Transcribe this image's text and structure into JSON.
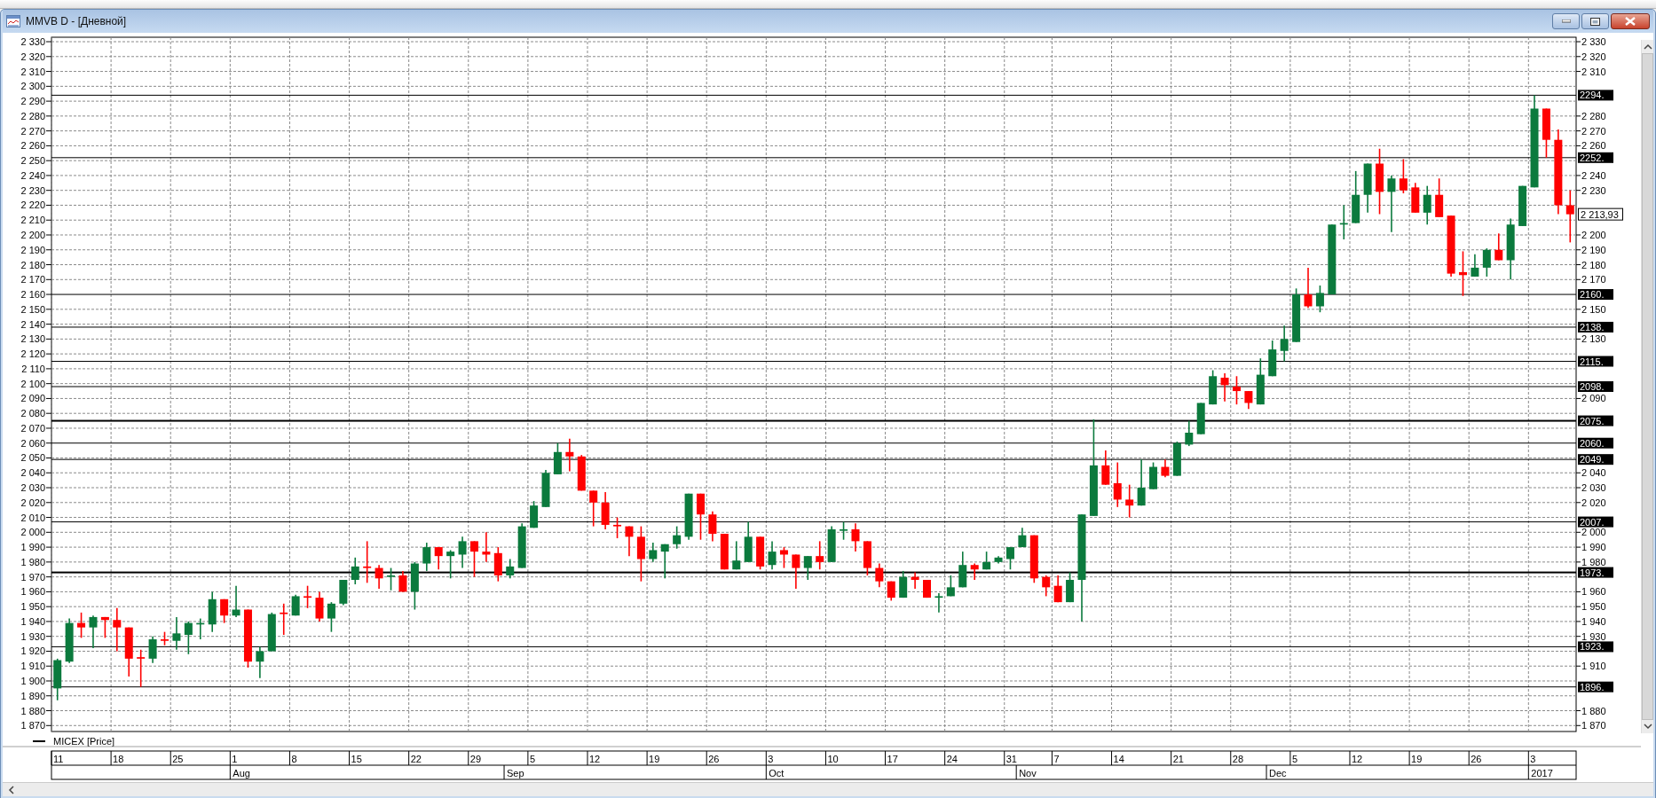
{
  "window": {
    "title": "MMVB D - [Дневной]"
  },
  "chart": {
    "chart_data": {
      "type": "candlestick",
      "grid": true,
      "categories": [
        "11",
        null,
        null,
        null,
        null,
        "18",
        null,
        null,
        null,
        null,
        "25",
        null,
        null,
        null,
        null,
        "1",
        null,
        null,
        null,
        null,
        "8",
        null,
        null,
        null,
        null,
        "15",
        null,
        null,
        null,
        null,
        "22",
        null,
        null,
        null,
        null,
        "29",
        null,
        null,
        null,
        null,
        "5",
        null,
        null,
        null,
        null,
        "12",
        null,
        null,
        null,
        null,
        "19",
        null,
        null,
        null,
        null,
        "26",
        null,
        null,
        null,
        null,
        "3",
        null,
        null,
        null,
        null,
        "10",
        null,
        null,
        null,
        null,
        "17",
        null,
        null,
        null,
        null,
        "24",
        null,
        null,
        null,
        null,
        "31",
        null,
        null,
        null,
        "7",
        null,
        null,
        null,
        null,
        "14",
        null,
        null,
        null,
        null,
        "21",
        null,
        null,
        null,
        null,
        "28",
        null,
        null,
        null,
        null,
        "5",
        null,
        null,
        null,
        null,
        "12",
        null,
        null,
        null,
        null,
        "19",
        null,
        null,
        null,
        null,
        "26",
        null,
        null,
        null,
        null,
        "3",
        null,
        null,
        null
      ],
      "series": [
        {
          "ohlc": [
            [
              1895,
              1915,
              1887,
              1914
            ],
            [
              1913,
              1942,
              1912,
              1939
            ],
            [
              1939,
              1946,
              1929,
              1936
            ],
            [
              1936,
              1944,
              1922,
              1943
            ],
            [
              1943,
              1943,
              1929,
              1941
            ],
            [
              1941,
              1949,
              1920,
              1936
            ],
            [
              1936,
              1936,
              1903,
              1915
            ],
            [
              1916,
              1921,
              1896,
              1915
            ],
            [
              1915,
              1930,
              1912,
              1928
            ],
            [
              1928,
              1933,
              1924,
              1927
            ],
            [
              1927,
              1943,
              1921,
              1932
            ],
            [
              1931,
              1940,
              1918,
              1939
            ],
            [
              1938,
              1942,
              1928,
              1939
            ],
            [
              1938,
              1960,
              1933,
              1955
            ],
            [
              1955,
              1955,
              1939,
              1944
            ],
            [
              1944,
              1964,
              1943,
              1948
            ],
            [
              1948,
              1948,
              1909,
              1913
            ],
            [
              1913,
              1923,
              1902,
              1920
            ],
            [
              1920,
              1946,
              1920,
              1945
            ],
            [
              1946,
              1952,
              1931,
              1945
            ],
            [
              1944,
              1958,
              1944,
              1957
            ],
            [
              1957,
              1964,
              1949,
              1956
            ],
            [
              1956,
              1960,
              1940,
              1942
            ],
            [
              1942,
              1953,
              1933,
              1952
            ],
            [
              1952,
              1968,
              1951,
              1968
            ],
            [
              1968,
              1983,
              1965,
              1977
            ],
            [
              1977,
              1994,
              1966,
              1976
            ],
            [
              1976,
              1978,
              1962,
              1969
            ],
            [
              1970,
              1976,
              1961,
              1971
            ],
            [
              1971,
              1974,
              1960,
              1960
            ],
            [
              1960,
              1980,
              1948,
              1979
            ],
            [
              1979,
              1993,
              1974,
              1990
            ],
            [
              1990,
              1990,
              1975,
              1984
            ],
            [
              1984,
              1988,
              1969,
              1987
            ],
            [
              1985,
              1997,
              1976,
              1994
            ],
            [
              1994,
              1994,
              1970,
              1987
            ],
            [
              1987,
              2000,
              1980,
              1985
            ],
            [
              1986,
              1990,
              1967,
              1971
            ],
            [
              1971,
              1982,
              1969,
              1977
            ],
            [
              1976,
              2006,
              1976,
              2004
            ],
            [
              2003,
              2021,
              2003,
              2018
            ],
            [
              2017,
              2042,
              2017,
              2040
            ],
            [
              2039,
              2060,
              2039,
              2054
            ],
            [
              2054,
              2063,
              2041,
              2051
            ],
            [
              2051,
              2052,
              2028,
              2028
            ],
            [
              2028,
              2028,
              2004,
              2020
            ],
            [
              2020,
              2027,
              2002,
              2005
            ],
            [
              2005,
              2010,
              1996,
              2004
            ],
            [
              2004,
              2004,
              1984,
              1997
            ],
            [
              1997,
              2004,
              1967,
              1982
            ],
            [
              1982,
              1993,
              1980,
              1988
            ],
            [
              1987,
              1992,
              1969,
              1992
            ],
            [
              1992,
              2004,
              1989,
              1998
            ],
            [
              1997,
              2026,
              1995,
              2026
            ],
            [
              2026,
              2026,
              1995,
              2012
            ],
            [
              2012,
              2014,
              1994,
              1999
            ],
            [
              1999,
              1999,
              1975,
              1975
            ],
            [
              1975,
              1994,
              1975,
              1981
            ],
            [
              1980,
              2007,
              1980,
              1997
            ],
            [
              1997,
              1997,
              1975,
              1977
            ],
            [
              1978,
              1994,
              1975,
              1987
            ],
            [
              1988,
              1990,
              1976,
              1985
            ],
            [
              1985,
              1985,
              1962,
              1976
            ],
            [
              1976,
              1984,
              1968,
              1984
            ],
            [
              1984,
              1994,
              1975,
              1980
            ],
            [
              1980,
              2004,
              1980,
              2002
            ],
            [
              2001,
              2007,
              1995,
              2002
            ],
            [
              2002,
              2006,
              1987,
              1994
            ],
            [
              1994,
              1994,
              1971,
              1976
            ],
            [
              1976,
              1979,
              1963,
              1967
            ],
            [
              1967,
              1967,
              1954,
              1956
            ],
            [
              1956,
              1974,
              1956,
              1970
            ],
            [
              1970,
              1973,
              1962,
              1968
            ],
            [
              1968,
              1968,
              1956,
              1956
            ],
            [
              1956,
              1959,
              1946,
              1957
            ],
            [
              1957,
              1971,
              1957,
              1963
            ],
            [
              1963,
              1987,
              1963,
              1978
            ],
            [
              1978,
              1979,
              1968,
              1975
            ],
            [
              1975,
              1987,
              1975,
              1980
            ],
            [
              1980,
              1984,
              1979,
              1983
            ],
            [
              1982,
              1990,
              1975,
              1990
            ],
            [
              1990,
              2003,
              1990,
              1998
            ],
            [
              1998,
              1998,
              1966,
              1969
            ],
            [
              1970,
              1971,
              1957,
              1963
            ],
            [
              1964,
              1971,
              1953,
              1953
            ],
            [
              1953,
              1973,
              1953,
              1968
            ],
            [
              1968,
              2012,
              1940,
              2012
            ],
            [
              2011,
              2076,
              2011,
              2045
            ],
            [
              2045,
              2055,
              2032,
              2032
            ],
            [
              2033,
              2047,
              2017,
              2022
            ],
            [
              2022,
              2032,
              2010,
              2018
            ],
            [
              2018,
              2049,
              2018,
              2030
            ],
            [
              2029,
              2047,
              2029,
              2044
            ],
            [
              2044,
              2049,
              2037,
              2038
            ],
            [
              2038,
              2061,
              2038,
              2060
            ],
            [
              2059,
              2075,
              2058,
              2067
            ],
            [
              2066,
              2087,
              2066,
              2087
            ],
            [
              2086,
              2109,
              2086,
              2105
            ],
            [
              2104,
              2107,
              2088,
              2099
            ],
            [
              2098,
              2105,
              2086,
              2095
            ],
            [
              2095,
              2095,
              2083,
              2087
            ],
            [
              2086,
              2117,
              2086,
              2106
            ],
            [
              2105,
              2129,
              2105,
              2123
            ],
            [
              2122,
              2139,
              2115,
              2130
            ],
            [
              2128,
              2164,
              2128,
              2160
            ],
            [
              2160,
              2178,
              2151,
              2152
            ],
            [
              2152,
              2166,
              2148,
              2161
            ],
            [
              2160,
              2207,
              2160,
              2207
            ],
            [
              2207,
              2220,
              2197,
              2208
            ],
            [
              2208,
              2243,
              2208,
              2227
            ],
            [
              2227,
              2248,
              2215,
              2248
            ],
            [
              2248,
              2258,
              2214,
              2229
            ],
            [
              2229,
              2240,
              2202,
              2238
            ],
            [
              2238,
              2251,
              2228,
              2230
            ],
            [
              2232,
              2235,
              2215,
              2215
            ],
            [
              2215,
              2233,
              2207,
              2227
            ],
            [
              2227,
              2238,
              2212,
              2212
            ],
            [
              2213,
              2213,
              2172,
              2174
            ],
            [
              2175,
              2189,
              2159,
              2173
            ],
            [
              2172,
              2187,
              2172,
              2178
            ],
            [
              2178,
              2191,
              2172,
              2190
            ],
            [
              2190,
              2201,
              2183,
              2183
            ],
            [
              2183,
              2211,
              2170,
              2207
            ],
            [
              2206,
              2233,
              2206,
              2233
            ],
            [
              2232,
              2294,
              2232,
              2285
            ],
            [
              2285,
              2285,
              2252,
              2264
            ],
            [
              2264,
              2271,
              2214,
              2220
            ],
            [
              2220,
              2230,
              2195,
              2213.93
            ]
          ]
        }
      ],
      "ylim": [
        1866,
        2333
      ],
      "yticks": [
        {
          "value": 2330,
          "label": "2 330"
        },
        {
          "value": 2320,
          "label": "2 320"
        },
        {
          "value": 2310,
          "label": "2 310"
        },
        {
          "value": 2300,
          "label": "2 300"
        },
        {
          "value": 2290,
          "label": "2 290"
        },
        {
          "value": 2280,
          "label": "2 280"
        },
        {
          "value": 2270,
          "label": "2 270"
        },
        {
          "value": 2260,
          "label": "2 260"
        },
        {
          "value": 2250,
          "label": "2 250"
        },
        {
          "value": 2240,
          "label": "2 240"
        },
        {
          "value": 2230,
          "label": "2 230"
        },
        {
          "value": 2220,
          "label": "2 220"
        },
        {
          "value": 2210,
          "label": "2 210"
        },
        {
          "value": 2200,
          "label": "2 200"
        },
        {
          "value": 2190,
          "label": "2 190"
        },
        {
          "value": 2180,
          "label": "2 180"
        },
        {
          "value": 2170,
          "label": "2 170"
        },
        {
          "value": 2160,
          "label": "2 160"
        },
        {
          "value": 2150,
          "label": "2 150"
        },
        {
          "value": 2140,
          "label": "2 140"
        },
        {
          "value": 2130,
          "label": "2 130"
        },
        {
          "value": 2120,
          "label": "2 120"
        },
        {
          "value": 2110,
          "label": "2 110"
        },
        {
          "value": 2100,
          "label": "2 100"
        },
        {
          "value": 2090,
          "label": "2 090"
        },
        {
          "value": 2080,
          "label": "2 080"
        },
        {
          "value": 2070,
          "label": "2 070"
        },
        {
          "value": 2060,
          "label": "2 060"
        },
        {
          "value": 2050,
          "label": "2 050"
        },
        {
          "value": 2040,
          "label": "2 040"
        },
        {
          "value": 2030,
          "label": "2 030"
        },
        {
          "value": 2020,
          "label": "2 020"
        },
        {
          "value": 2010,
          "label": "2 010"
        },
        {
          "value": 2000,
          "label": "2 000"
        },
        {
          "value": 1990,
          "label": "1 990"
        },
        {
          "value": 1980,
          "label": "1 980"
        },
        {
          "value": 1970,
          "label": "1 970"
        },
        {
          "value": 1960,
          "label": "1 960"
        },
        {
          "value": 1950,
          "label": "1 950"
        },
        {
          "value": 1940,
          "label": "1 940"
        },
        {
          "value": 1930,
          "label": "1 930"
        },
        {
          "value": 1920,
          "label": "1 920"
        },
        {
          "value": 1910,
          "label": "1 910"
        },
        {
          "value": 1900,
          "label": "1 900"
        },
        {
          "value": 1890,
          "label": "1 890"
        },
        {
          "value": 1880,
          "label": "1 880"
        },
        {
          "value": 1870,
          "label": "1 870"
        }
      ],
      "ref_lines": [
        {
          "axis": "y",
          "value": 2294,
          "label": "2294."
        },
        {
          "axis": "y",
          "value": 2252,
          "label": "2252."
        },
        {
          "axis": "y",
          "value": 2160,
          "label": "2160."
        },
        {
          "axis": "y",
          "value": 2138,
          "label": "2138."
        },
        {
          "axis": "y",
          "value": 2115,
          "label": "2115."
        },
        {
          "axis": "y",
          "value": 2098,
          "label": "2098."
        },
        {
          "axis": "y",
          "value": 2075,
          "label": "2075."
        },
        {
          "axis": "y",
          "value": 2060,
          "label": "2060."
        },
        {
          "axis": "y",
          "value": 2049,
          "label": "2049."
        },
        {
          "axis": "y",
          "value": 2007,
          "label": "2007."
        },
        {
          "axis": "y",
          "value": 1973,
          "label": "1973."
        },
        {
          "axis": "y",
          "value": 1923,
          "label": "1923."
        },
        {
          "axis": "y",
          "value": 1896,
          "label": "1896."
        }
      ]
    },
    "level_lines": [
      {
        "thick": false
      },
      {
        "thick": false
      },
      {
        "thick": false
      },
      {
        "thick": false
      },
      {
        "thick": false
      },
      {
        "thick": false
      },
      {
        "thick": true
      },
      {
        "thick": false
      },
      {
        "thick": false
      },
      {
        "thick": false
      },
      {
        "thick": true
      },
      {
        "thick": false
      },
      {
        "thick": false
      }
    ],
    "legend": "MICEX [Price]",
    "last_price": "2 213,93",
    "months": [
      "Aug",
      "Sep",
      "Oct",
      "Nov",
      "Dec",
      "2017"
    ]
  }
}
